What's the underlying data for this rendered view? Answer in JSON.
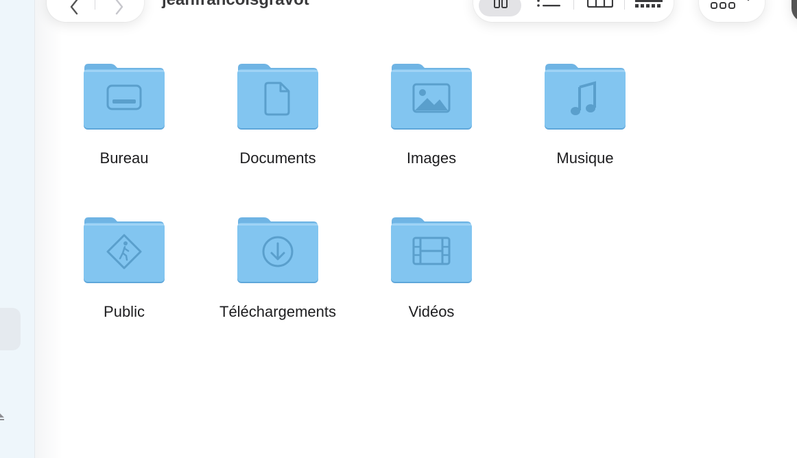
{
  "window": {
    "title": "jeanfrancoisgravot"
  },
  "toolbar": {
    "back_icon": "chevron-left-icon",
    "forward_icon": "chevron-right-icon",
    "views": [
      "icon-view-icon",
      "list-view-icon",
      "column-view-icon",
      "gallery-view-icon"
    ],
    "more_icon": "more-icon"
  },
  "folders": [
    {
      "label": "Bureau",
      "icon": "desktop-icon"
    },
    {
      "label": "Documents",
      "icon": "document-icon"
    },
    {
      "label": "Images",
      "icon": "picture-icon"
    },
    {
      "label": "Musique",
      "icon": "music-note-icon"
    },
    {
      "label": "Public",
      "icon": "pedestrian-sign-icon"
    },
    {
      "label": "Téléchargements",
      "icon": "download-arrow-icon"
    },
    {
      "label": "Vidéos",
      "icon": "film-icon"
    }
  ],
  "colors": {
    "folder_back": "#6fb4e4",
    "folder_front": "#82c5f0",
    "folder_glyph": "#5a9fcc",
    "sidebar_bg": "#eef6fb"
  }
}
